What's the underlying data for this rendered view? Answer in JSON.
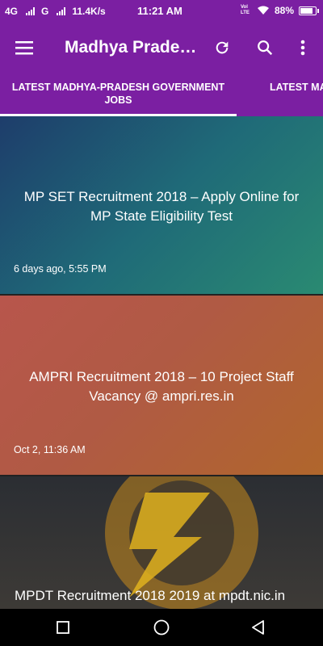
{
  "status": {
    "network1": "4G",
    "network2": "G",
    "speed": "11.4K/s",
    "time": "11:21 AM",
    "volte": "Vol LTE",
    "battery_text": "88%",
    "battery_level": 0.88
  },
  "toolbar": {
    "title": "Madhya Pradesh Govt Jobs",
    "menu_icon": "hamburger-menu-icon",
    "refresh_icon": "refresh-icon",
    "search_icon": "search-icon",
    "more_icon": "more-vertical-icon"
  },
  "tabs": [
    {
      "label": "LATEST MADHYA-PRADESH GOVERNMENT JOBS",
      "active": true
    },
    {
      "label": "LATEST MA",
      "active": false
    }
  ],
  "posts": [
    {
      "title": "MP SET Recruitment 2018 – Apply Online for MP State Eligibility Test",
      "time": "6 days ago, 5:55 PM"
    },
    {
      "title": "AMPRI Recruitment 2018 – 10 Project Staff Vacancy @ ampri.res.in",
      "time": "Oct 2, 11:36 AM"
    },
    {
      "title": "MPDT Recruitment 2018 2019 at mpdt.nic.in",
      "time": ""
    }
  ],
  "nav": {
    "recents_icon": "square-recents-icon",
    "home_icon": "circle-home-icon",
    "back_icon": "triangle-back-icon"
  }
}
